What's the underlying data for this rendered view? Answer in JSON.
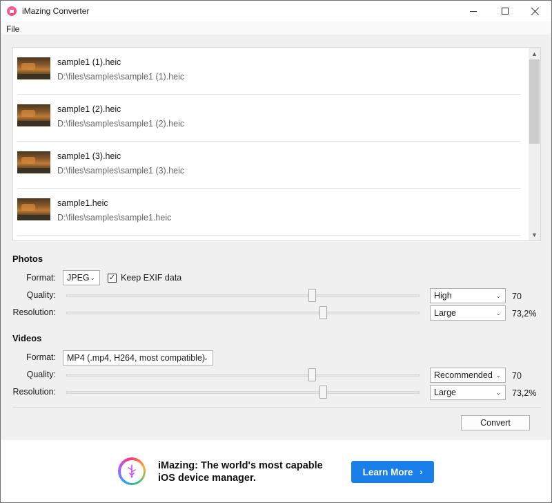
{
  "window": {
    "title": "iMazing Converter",
    "icon": "imazing-app-icon"
  },
  "menu": {
    "items": [
      "File"
    ]
  },
  "files": [
    {
      "name": "sample1 (1).heic",
      "path": "D:\\files\\samples\\sample1 (1).heic"
    },
    {
      "name": "sample1 (2).heic",
      "path": "D:\\files\\samples\\sample1 (2).heic"
    },
    {
      "name": "sample1 (3).heic",
      "path": "D:\\files\\samples\\sample1 (3).heic"
    },
    {
      "name": "sample1.heic",
      "path": "D:\\files\\samples\\sample1.heic"
    }
  ],
  "photos": {
    "section_title": "Photos",
    "format_label": "Format:",
    "format_value": "JPEG",
    "keep_exif_label": "Keep EXIF data",
    "keep_exif_checked": true,
    "quality_label": "Quality:",
    "quality_preset": "High",
    "quality_value": "70",
    "quality_fraction": 0.7,
    "resolution_label": "Resolution:",
    "resolution_preset": "Large",
    "resolution_value": "73,2%",
    "resolution_fraction": 0.732
  },
  "videos": {
    "section_title": "Videos",
    "format_label": "Format:",
    "format_value": "MP4 (.mp4, H264, most compatible)",
    "quality_label": "Quality:",
    "quality_preset": "Recommended",
    "quality_value": "70",
    "quality_fraction": 0.7,
    "resolution_label": "Resolution:",
    "resolution_preset": "Large",
    "resolution_value": "73,2%",
    "resolution_fraction": 0.732
  },
  "actions": {
    "convert_label": "Convert"
  },
  "ad": {
    "headline": "iMazing: The world's most capable iOS device manager.",
    "cta_label": "Learn More",
    "cta_color": "#1a7fe8",
    "logo": "imazing-logo-icon"
  }
}
